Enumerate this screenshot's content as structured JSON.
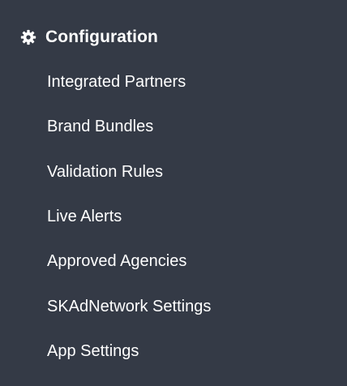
{
  "section": {
    "title": "Configuration",
    "icon": "gear-icon"
  },
  "items": [
    {
      "label": "Integrated Partners"
    },
    {
      "label": "Brand Bundles"
    },
    {
      "label": "Validation Rules"
    },
    {
      "label": "Live Alerts"
    },
    {
      "label": "Approved Agencies"
    },
    {
      "label": "SKAdNetwork Settings"
    },
    {
      "label": "App Settings"
    }
  ],
  "colors": {
    "background": "#343a46",
    "text": "#ffffff"
  }
}
